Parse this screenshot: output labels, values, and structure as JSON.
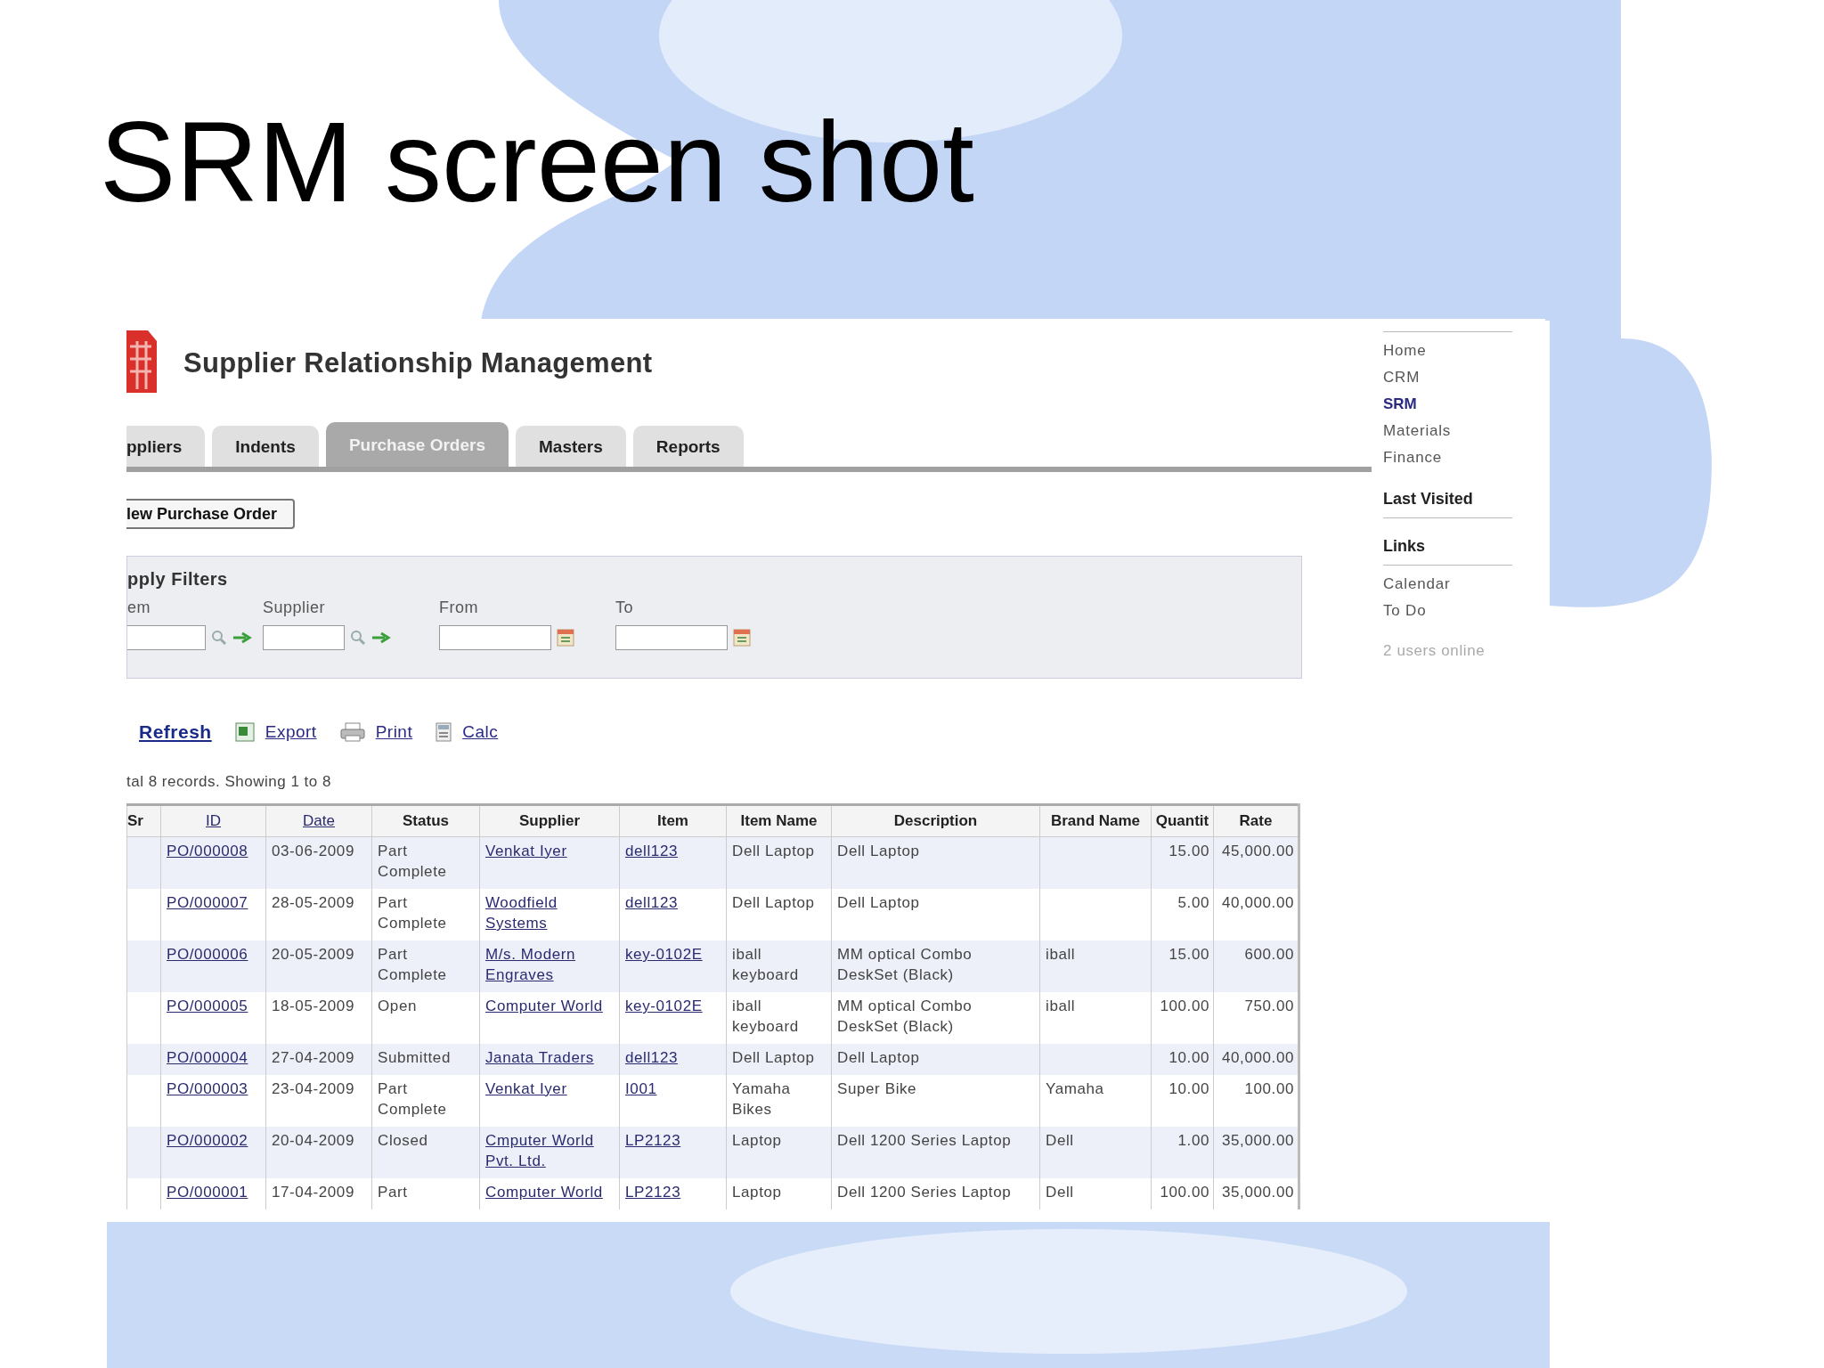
{
  "slide": {
    "title": "SRM screen shot"
  },
  "app": {
    "title": "Supplier Relationship Management"
  },
  "tabs": [
    {
      "label": "ppliers",
      "selected": false
    },
    {
      "label": "Indents",
      "selected": false
    },
    {
      "label": "Purchase Orders",
      "selected": true
    },
    {
      "label": "Masters",
      "selected": false
    },
    {
      "label": "Reports",
      "selected": false
    }
  ],
  "new_button": "lew Purchase Order",
  "filters": {
    "title": "pply Filters",
    "fields": [
      {
        "label": "em",
        "kind": "lookup"
      },
      {
        "label": "Supplier",
        "kind": "lookup"
      },
      {
        "label": "From",
        "kind": "date"
      },
      {
        "label": "To",
        "kind": "date"
      }
    ]
  },
  "actions": [
    {
      "label": "Refresh",
      "kind": "refresh"
    },
    {
      "label": "Export",
      "kind": "export"
    },
    {
      "label": "Print",
      "kind": "print"
    },
    {
      "label": "Calc",
      "kind": "calc"
    }
  ],
  "record_info": "tal 8 records. Showing 1 to 8",
  "table": {
    "columns": [
      {
        "label": "Sr",
        "link": false
      },
      {
        "label": "ID",
        "link": true
      },
      {
        "label": "Date",
        "link": true
      },
      {
        "label": "Status",
        "link": false
      },
      {
        "label": "Supplier",
        "link": false
      },
      {
        "label": "Item",
        "link": false
      },
      {
        "label": "Item Name",
        "link": false
      },
      {
        "label": "Description",
        "link": false
      },
      {
        "label": "Brand Name",
        "link": false
      },
      {
        "label": "Quantit",
        "link": false
      },
      {
        "label": "Rate",
        "link": false
      }
    ],
    "rows": [
      {
        "id": "PO/000008",
        "date": "03-06-2009",
        "status": "Part Complete",
        "supplier": "Venkat Iyer",
        "item": "dell123",
        "item_name": "Dell Laptop",
        "description": "Dell Laptop",
        "brand": "",
        "quantity": "15.00",
        "rate": "45,000.00"
      },
      {
        "id": "PO/000007",
        "date": "28-05-2009",
        "status": "Part Complete",
        "supplier": "Woodfield Systems",
        "item": "dell123",
        "item_name": "Dell Laptop",
        "description": "Dell Laptop",
        "brand": "",
        "quantity": "5.00",
        "rate": "40,000.00"
      },
      {
        "id": "PO/000006",
        "date": "20-05-2009",
        "status": "Part Complete",
        "supplier": "M/s. Modern Engraves",
        "item": "key-0102E",
        "item_name": "iball keyboard",
        "description": "MM optical Combo DeskSet (Black)",
        "brand": "iball",
        "quantity": "15.00",
        "rate": "600.00"
      },
      {
        "id": "PO/000005",
        "date": "18-05-2009",
        "status": "Open",
        "supplier": "Computer World",
        "item": "key-0102E",
        "item_name": "iball keyboard",
        "description": "MM optical Combo DeskSet (Black)",
        "brand": "iball",
        "quantity": "100.00",
        "rate": "750.00"
      },
      {
        "id": "PO/000004",
        "date": "27-04-2009",
        "status": "Submitted",
        "supplier": "Janata Traders",
        "item": "dell123",
        "item_name": "Dell Laptop",
        "description": "Dell Laptop",
        "brand": "",
        "quantity": "10.00",
        "rate": "40,000.00"
      },
      {
        "id": "PO/000003",
        "date": "23-04-2009",
        "status": "Part Complete",
        "supplier": "Venkat Iyer",
        "item": "I001",
        "item_name": "Yamaha Bikes",
        "description": "Super Bike",
        "brand": "Yamaha",
        "quantity": "10.00",
        "rate": "100.00"
      },
      {
        "id": "PO/000002",
        "date": "20-04-2009",
        "status": "Closed",
        "supplier": "Cmputer World Pvt. Ltd.",
        "item": "LP2123",
        "item_name": "Laptop",
        "description": "Dell 1200 Series Laptop",
        "brand": "Dell",
        "quantity": "1.00",
        "rate": "35,000.00"
      },
      {
        "id": "PO/000001",
        "date": "17-04-2009",
        "status": "Part",
        "supplier": "Computer World",
        "item": "LP2123",
        "item_name": "Laptop",
        "description": "Dell 1200 Series Laptop",
        "brand": "Dell",
        "quantity": "100.00",
        "rate": "35,000.00"
      }
    ]
  },
  "sidebar": {
    "nav": [
      {
        "label": "Home",
        "selected": false
      },
      {
        "label": "CRM",
        "selected": false
      },
      {
        "label": "SRM",
        "selected": true
      },
      {
        "label": "Materials",
        "selected": false
      },
      {
        "label": "Finance",
        "selected": false
      }
    ],
    "last_visited": "Last Visited",
    "links_title": "Links",
    "links": [
      "Calendar",
      "To Do"
    ],
    "online": "2 users online"
  }
}
